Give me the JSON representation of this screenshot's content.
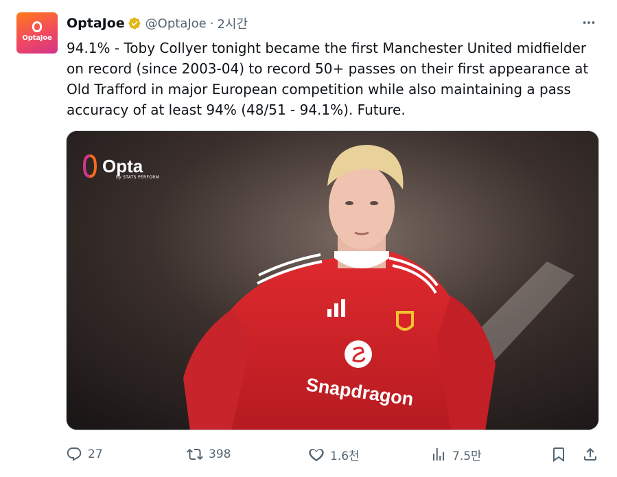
{
  "author": {
    "display_name": "OptaJoe",
    "handle": "@OptaJoe",
    "separator": "·",
    "time_ago": "2시간",
    "avatar_logo_text": "OptaJoe",
    "verified_badge_color": "#e2b719"
  },
  "tweet": {
    "text": "94.1% - Toby Collyer tonight became the first Manchester United midfielder on record (since 2003-04) to record 50+ passes on their first appearance at Old Trafford in major European competition while also maintaining a pass accuracy of at least 94% (48/51 - 94.1%). Future."
  },
  "media": {
    "brand_logo": "Opta",
    "brand_sub": "by STATS PERFORM",
    "shirt_sponsor": "Snapdragon",
    "description_icon": "player-photo"
  },
  "actions": {
    "reply_count": "27",
    "retweet_count": "398",
    "like_count": "1.6천",
    "view_count": "7.5만"
  },
  "colors": {
    "text_primary": "#0f1419",
    "text_secondary": "#536471",
    "shirt_red": "#d8232a"
  }
}
